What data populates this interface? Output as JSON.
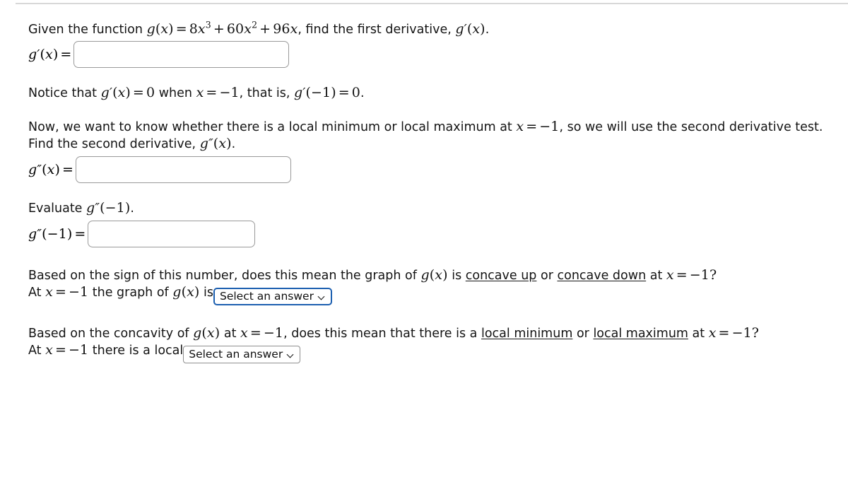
{
  "problem": {
    "intro_prefix": "Given the function",
    "intro_function": "g(x) = 8x^3 + 60x^2 + 96x",
    "intro_suffix": ", find the first derivative,",
    "intro_target": "g'(x)",
    "intro_period": ".",
    "first_derivative_label": "g'(x) =",
    "first_derivative_value": "",
    "first_derivative_placeholder": "",
    "notice_text_a": "Notice that",
    "notice_math_a": "g'(x) = 0",
    "notice_text_b": "when",
    "notice_math_b": "x = -1",
    "notice_text_c": ", that is,",
    "notice_math_c": "g'(-1) = 0",
    "notice_period": ".",
    "second_test_line1_a": "Now, we want to know whether there is a local minimum or local maximum at",
    "second_test_line1_math": "x = -1",
    "second_test_line1_b": ", so we will use the second derivative test.",
    "second_test_line2_a": "Find the second derivative,",
    "second_test_line2_math": "g''(x)",
    "second_test_line2_b": ".",
    "second_derivative_label": "g''(x) =",
    "second_derivative_value": "",
    "second_derivative_placeholder": "",
    "evaluate_text": "Evaluate",
    "evaluate_math": "g''(-1)",
    "evaluate_period": ".",
    "evaluate_label": "g''(-1) =",
    "evaluate_value": "",
    "evaluate_placeholder": "",
    "concavity_q_a": "Based on the sign of this number, does this mean the graph of",
    "concavity_q_math_g": "g(x)",
    "concavity_q_b": "is",
    "concavity_option_1": "concave up",
    "concavity_q_or": "or",
    "concavity_option_2": "concave down",
    "concavity_q_c": "at",
    "concavity_q_math_x": "x = -1?",
    "concavity_answer_a": "At",
    "concavity_answer_math": "x = -1",
    "concavity_answer_b": "the graph of",
    "concavity_answer_math_g": "g(x)",
    "concavity_answer_c": "is",
    "extremum_q_a": "Based on the concavity of",
    "extremum_q_math_g": "g(x)",
    "extremum_q_b": "at",
    "extremum_q_math_x": "x = -1",
    "extremum_q_c": ", does this mean that there is a",
    "extremum_option_1": "local minimum",
    "extremum_q_or": "or",
    "extremum_option_2": "local maximum",
    "extremum_q_d": "at",
    "extremum_q_math_x2": "x = -1?",
    "extremum_answer_a": "At",
    "extremum_answer_math": "x = -1",
    "extremum_answer_b": "there is a local"
  },
  "selects": {
    "concavity": {
      "label": "Select an answer",
      "chevron": "chevron-down-icon",
      "focused": true
    },
    "extremum": {
      "label": "Select an answer",
      "chevron": "chevron-down-icon",
      "focused": false
    }
  },
  "colors": {
    "focus_border": "#1c5fb0",
    "field_border": "#9a9a9a",
    "text": "#141414",
    "rule": "#d8d8d8"
  }
}
